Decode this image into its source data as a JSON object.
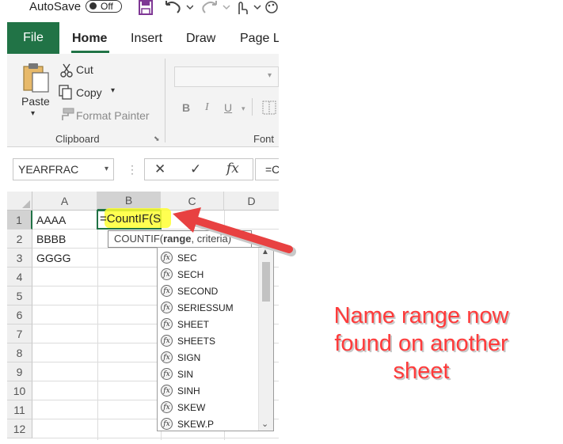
{
  "titlebar": {
    "autosave_label": "AutoSave",
    "autosave_state": "Off"
  },
  "tabs": {
    "file": "File",
    "home": "Home",
    "insert": "Insert",
    "draw": "Draw",
    "page_layout": "Page L"
  },
  "ribbon": {
    "paste_label": "Paste",
    "cut_label": "Cut",
    "copy_label": "Copy",
    "format_painter_label": "Format Painter",
    "clipboard_group": "Clipboard",
    "font_group": "Font",
    "bold": "B",
    "italic": "I",
    "underline": "U"
  },
  "formula_bar": {
    "name_box": "YEARFRAC",
    "cancel": "✕",
    "enter": "✓",
    "fx": "fx",
    "formula_preview": "=C"
  },
  "grid": {
    "columns": [
      "A",
      "B",
      "C",
      "D"
    ],
    "rows": [
      "1",
      "2",
      "3",
      "4",
      "5",
      "6",
      "7",
      "8",
      "9",
      "10",
      "11",
      "12"
    ],
    "cells": {
      "A1": "AAAA",
      "A2": "BBBB",
      "A3": "GGGG",
      "B1_prefix": "=",
      "B1_highlight": "CountIF(S"
    }
  },
  "tooltip": {
    "func": "COUNTIF(",
    "arg1": "range",
    "rest": ", criteria)"
  },
  "autocomplete": {
    "items": [
      "SEC",
      "SECH",
      "SECOND",
      "SERIESSUM",
      "SHEET",
      "SHEETS",
      "SIGN",
      "SIN",
      "SINH",
      "SKEW",
      "SKEW.P"
    ],
    "icon_glyph": "fx"
  },
  "annotation": {
    "line1": "Name range now",
    "line2": "found on another",
    "line3": "sheet"
  },
  "colors": {
    "excel_green": "#217346",
    "highlight": "#ffff33",
    "annotation": "#ff3b3b",
    "arrow": "#e84141"
  }
}
